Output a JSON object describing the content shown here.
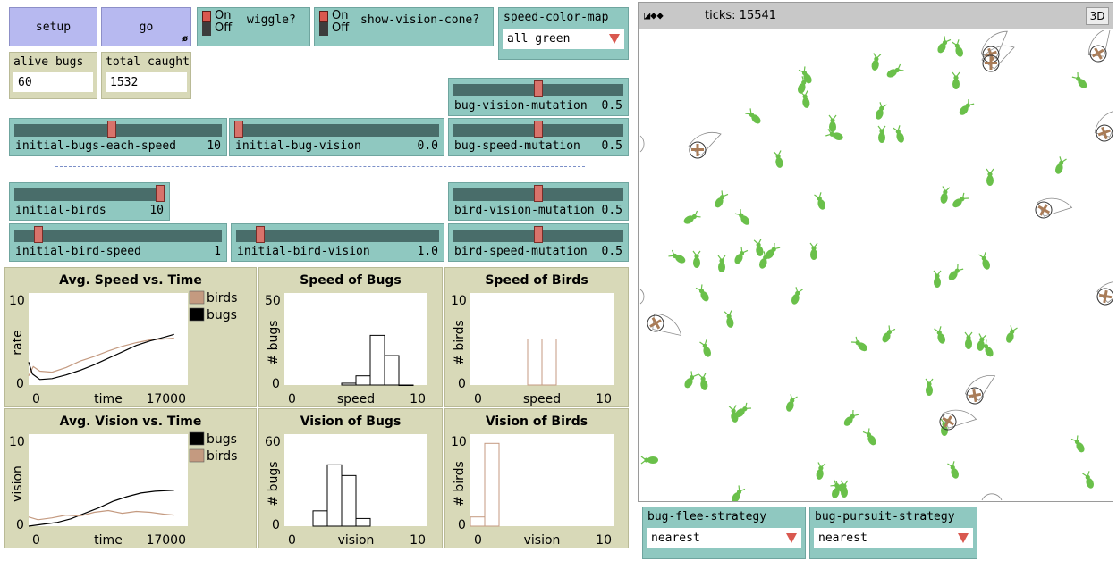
{
  "buttons": {
    "setup": "setup",
    "go": "go",
    "go_forever_glyph": "ø"
  },
  "switches": [
    {
      "label": "wiggle?",
      "on_text": "On",
      "off_text": "Off",
      "state": "on"
    },
    {
      "label": "show-vision-cone?",
      "on_text": "On",
      "off_text": "Off",
      "state": "on"
    }
  ],
  "speed_color_map": {
    "label": "speed-color-map",
    "value": "all green"
  },
  "monitors": [
    {
      "label": "alive bugs",
      "value": "60"
    },
    {
      "label": "total caught",
      "value": "1532"
    }
  ],
  "sliders": {
    "bug_vision_mutation": {
      "label": "bug-vision-mutation",
      "value": "0.5",
      "level": 0.5
    },
    "initial_bugs_each_speed": {
      "label": "initial-bugs-each-speed",
      "value": "10",
      "level": 0.47
    },
    "initial_bug_vision": {
      "label": "initial-bug-vision",
      "value": "0.0",
      "level": 0.0
    },
    "bug_speed_mutation": {
      "label": "bug-speed-mutation",
      "value": "0.5",
      "level": 0.5
    },
    "initial_birds": {
      "label": "initial-birds",
      "value": "10",
      "level": 1.0
    },
    "bird_vision_mutation": {
      "label": "bird-vision-mutation",
      "value": "0.5",
      "level": 0.5
    },
    "initial_bird_speed": {
      "label": "initial-bird-speed",
      "value": "1",
      "level": 0.1
    },
    "initial_bird_vision": {
      "label": "initial-bird-vision",
      "value": "1.0",
      "level": 0.1
    },
    "bird_speed_mutation": {
      "label": "bird-speed-mutation",
      "value": "0.5",
      "level": 0.5
    }
  },
  "view": {
    "ticks_label": "ticks: 15541",
    "three_d": "3D",
    "controls": "◪◆◆"
  },
  "bug_flee_strategy": {
    "label": "bug-flee-strategy",
    "value": "nearest"
  },
  "bug_pursuit_strategy": {
    "label": "bug-pursuit-strategy",
    "value": "nearest"
  },
  "colors": {
    "bug": "#6ac04a",
    "bird": "#a97c58",
    "bugs_series": "#000000",
    "birds_series": "#c49a80"
  },
  "chart_data": [
    {
      "type": "line",
      "title": "Avg. Speed vs. Time",
      "xlabel": "time",
      "ylabel": "rate",
      "xlim": [
        0,
        17000
      ],
      "ylim": [
        0,
        10
      ],
      "x_ticks": [
        "0",
        "17000"
      ],
      "y_ticks": [
        "10",
        "0"
      ],
      "legend": "top-right",
      "series": [
        {
          "name": "birds",
          "color": "#c49a80",
          "x": [
            0,
            500,
            1200,
            2500,
            4000,
            5500,
            7000,
            8500,
            10000,
            11500,
            13000,
            14500,
            15541
          ],
          "y": [
            1.0,
            2.0,
            1.5,
            1.4,
            1.9,
            2.6,
            3.1,
            3.7,
            4.2,
            4.6,
            4.9,
            5.0,
            5.1
          ]
        },
        {
          "name": "bugs",
          "color": "#000000",
          "x": [
            0,
            400,
            1200,
            2500,
            4000,
            5500,
            7000,
            8500,
            10000,
            11500,
            13000,
            14500,
            15541
          ],
          "y": [
            2.5,
            1.2,
            0.6,
            0.7,
            1.1,
            1.6,
            2.2,
            2.9,
            3.6,
            4.3,
            4.8,
            5.2,
            5.5
          ]
        }
      ]
    },
    {
      "type": "bar",
      "title": "Speed of Bugs",
      "xlabel": "speed",
      "ylabel": "# bugs",
      "xlim": [
        0,
        10
      ],
      "ylim": [
        0,
        50
      ],
      "x_ticks": [
        "0",
        "10"
      ],
      "y_ticks": [
        "50",
        "0"
      ],
      "bin_width": 1,
      "bins": [
        4,
        5,
        6,
        7,
        8
      ],
      "values": [
        1,
        5,
        27,
        16,
        0
      ]
    },
    {
      "type": "bar",
      "title": "Speed of Birds",
      "xlabel": "speed",
      "ylabel": "# birds",
      "xlim": [
        0,
        10
      ],
      "ylim": [
        0,
        10
      ],
      "x_ticks": [
        "0",
        "10"
      ],
      "y_ticks": [
        "10",
        "0"
      ],
      "bin_width": 1,
      "bins": [
        4,
        5
      ],
      "values": [
        5,
        5
      ]
    },
    {
      "type": "line",
      "title": "Avg. Vision vs. Time",
      "xlabel": "time",
      "ylabel": "vision",
      "xlim": [
        0,
        17000
      ],
      "ylim": [
        0,
        10
      ],
      "x_ticks": [
        "0",
        "17000"
      ],
      "y_ticks": [
        "10",
        "0"
      ],
      "legend": "top-right",
      "series": [
        {
          "name": "bugs",
          "color": "#000000",
          "x": [
            0,
            1500,
            3000,
            4500,
            6000,
            7500,
            9000,
            10500,
            12000,
            13500,
            15541
          ],
          "y": [
            0.0,
            0.2,
            0.4,
            0.8,
            1.4,
            2.0,
            2.7,
            3.2,
            3.6,
            3.8,
            3.9
          ]
        },
        {
          "name": "birds",
          "color": "#c49a80",
          "x": [
            0,
            1000,
            2500,
            4000,
            5500,
            7000,
            8500,
            10000,
            11500,
            13000,
            14500,
            15541
          ],
          "y": [
            1.0,
            0.7,
            0.9,
            1.2,
            1.1,
            1.5,
            1.7,
            1.4,
            1.6,
            1.5,
            1.3,
            1.2
          ]
        }
      ]
    },
    {
      "type": "bar",
      "title": "Vision of Bugs",
      "xlabel": "vision",
      "ylabel": "# bugs",
      "xlim": [
        0,
        10
      ],
      "ylim": [
        0,
        60
      ],
      "x_ticks": [
        "0",
        "10"
      ],
      "y_ticks": [
        "60",
        "0"
      ],
      "bin_width": 1,
      "bins": [
        2,
        3,
        4,
        5
      ],
      "values": [
        10,
        40,
        33,
        5
      ]
    },
    {
      "type": "bar",
      "title": "Vision of Birds",
      "xlabel": "vision",
      "ylabel": "# birds",
      "xlim": [
        0,
        10
      ],
      "ylim": [
        0,
        10
      ],
      "x_ticks": [
        "0",
        "10"
      ],
      "y_ticks": [
        "10",
        "0"
      ],
      "bin_width": 1,
      "bins": [
        0,
        1
      ],
      "values": [
        1,
        9
      ]
    }
  ]
}
